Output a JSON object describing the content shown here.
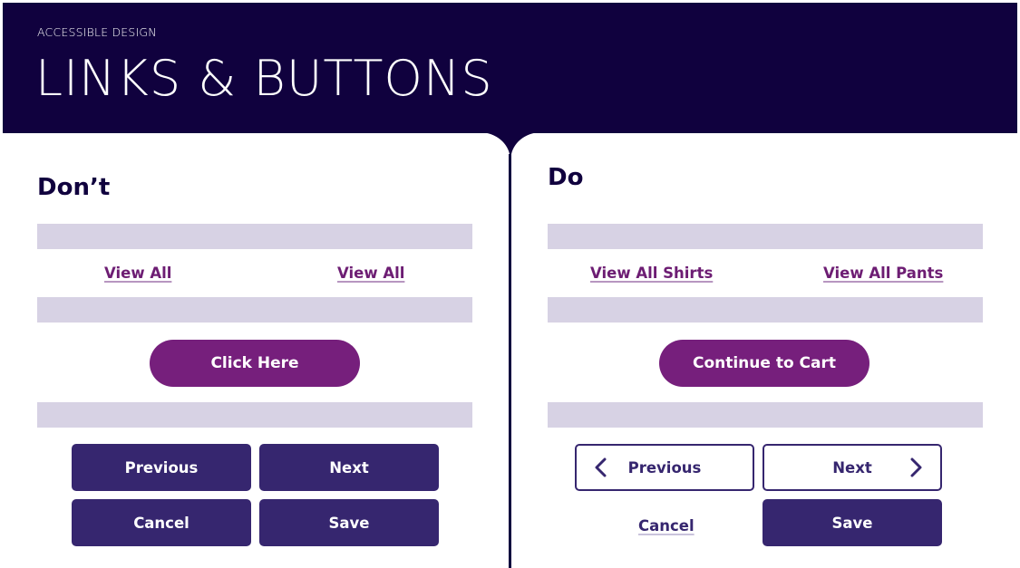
{
  "header": {
    "eyebrow": "ACCESSIBLE DESIGN",
    "title": "LINKS & BUTTONS"
  },
  "colors": {
    "header_bg": "#10013e",
    "placeholder_bar": "#d7d2e4",
    "accent_purple": "#761f7c",
    "button_navy": "#36266f",
    "link_text": "#6d1d73"
  },
  "dont": {
    "heading": "Don’t",
    "links": [
      "View All",
      "View All"
    ],
    "cta": "Click Here",
    "buttons": {
      "previous": "Previous",
      "next": "Next",
      "cancel": "Cancel",
      "save": "Save"
    }
  },
  "do": {
    "heading": "Do",
    "links": [
      "View All Shirts",
      "View All Pants"
    ],
    "cta": "Continue to Cart",
    "buttons": {
      "previous": "Previous",
      "next": "Next",
      "cancel": "Cancel",
      "save": "Save"
    },
    "icons": {
      "previous": "chevron-left-icon",
      "next": "chevron-right-icon"
    }
  }
}
